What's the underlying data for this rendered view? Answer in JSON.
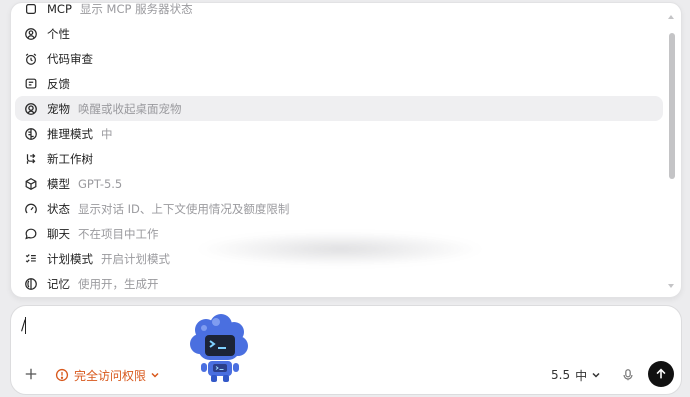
{
  "menu": {
    "items": [
      {
        "icon": "mcp-icon",
        "label": "MCP",
        "desc": "显示 MCP 服务器状态",
        "highlighted": false
      },
      {
        "icon": "personality-icon",
        "label": "个性",
        "desc": "",
        "highlighted": false
      },
      {
        "icon": "alarm-clock-icon",
        "label": "代码审查",
        "desc": "",
        "highlighted": false
      },
      {
        "icon": "feedback-icon",
        "label": "反馈",
        "desc": "",
        "highlighted": false
      },
      {
        "icon": "pet-icon",
        "label": "宠物",
        "desc": "唤醒或收起桌面宠物",
        "highlighted": true
      },
      {
        "icon": "brain-icon",
        "label": "推理模式",
        "desc": "中",
        "highlighted": false
      },
      {
        "icon": "branch-icon",
        "label": "新工作树",
        "desc": "",
        "highlighted": false
      },
      {
        "icon": "cube-icon",
        "label": "模型",
        "desc": "GPT-5.5",
        "highlighted": false
      },
      {
        "icon": "gauge-icon",
        "label": "状态",
        "desc": "显示对话 ID、上下文使用情况及额度限制",
        "highlighted": false
      },
      {
        "icon": "chat-bubble-icon",
        "label": "聊天",
        "desc": "不在项目中工作",
        "highlighted": false
      },
      {
        "icon": "checklist-icon",
        "label": "计划模式",
        "desc": "开启计划模式",
        "highlighted": false
      },
      {
        "icon": "memory-icon",
        "label": "记忆",
        "desc": "使用开，生成开",
        "highlighted": false
      }
    ]
  },
  "composer": {
    "input_value": "/",
    "access_label": "完全访问权限",
    "model_name": "5.5",
    "reasoning_level": "中"
  },
  "colors": {
    "accent_warning": "#d8581c",
    "send_button": "#111111",
    "highlight_row": "#efeff1",
    "pet_body": "#4a6fe0"
  }
}
